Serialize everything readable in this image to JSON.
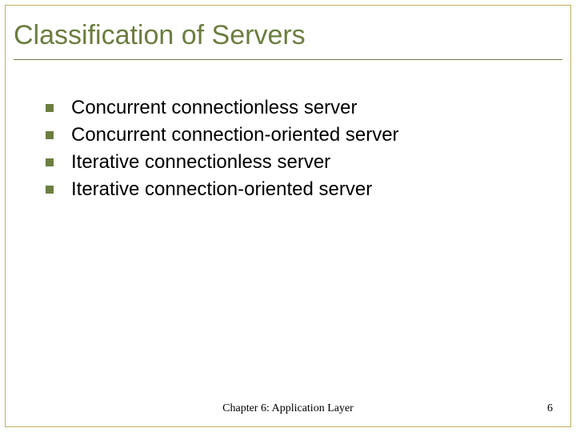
{
  "title": "Classification of Servers",
  "bullets": [
    "Concurrent connectionless server",
    "Concurrent connection-oriented server",
    "Iterative connectionless server",
    "Iterative connection-oriented server"
  ],
  "footer": "Chapter 6: Application Layer",
  "pageNumber": "6"
}
